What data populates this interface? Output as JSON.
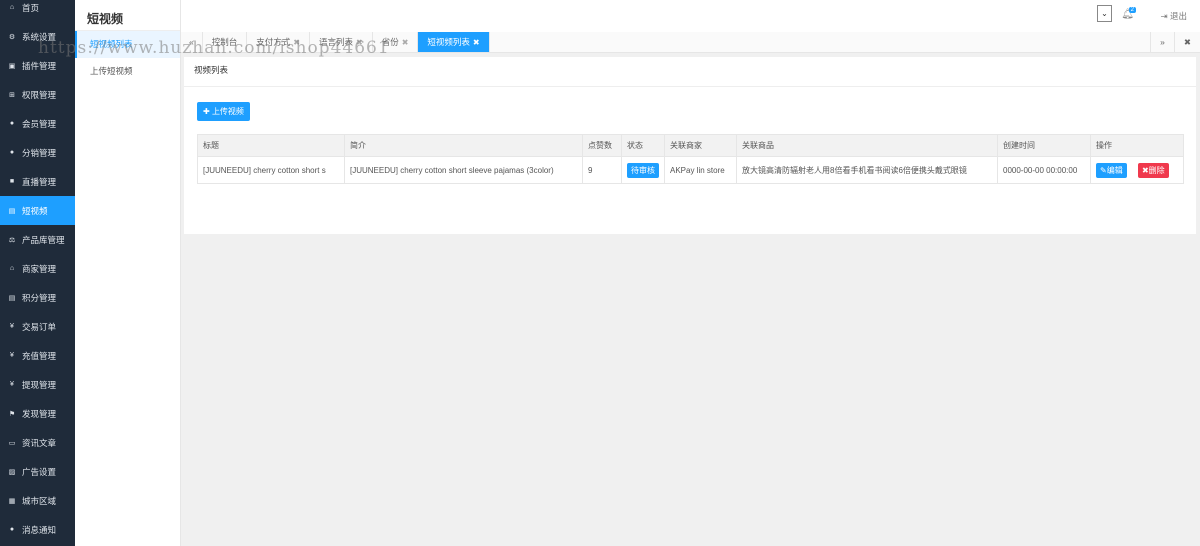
{
  "sidebar": {
    "items": [
      {
        "label": "首页",
        "icon": "home-icon"
      },
      {
        "label": "系统设置",
        "icon": "gear-icon"
      },
      {
        "label": "插件管理",
        "icon": "plugin-icon"
      },
      {
        "label": "权限管理",
        "icon": "sitemap-icon"
      },
      {
        "label": "会员管理",
        "icon": "users-icon"
      },
      {
        "label": "分销管理",
        "icon": "users-icon"
      },
      {
        "label": "直播管理",
        "icon": "video-icon"
      },
      {
        "label": "短视频",
        "icon": "file-icon",
        "active": true
      },
      {
        "label": "产品库管理",
        "icon": "scale-icon"
      },
      {
        "label": "商家管理",
        "icon": "bank-icon"
      },
      {
        "label": "积分管理",
        "icon": "doc-icon"
      },
      {
        "label": "交易订单",
        "icon": "yen-icon"
      },
      {
        "label": "充值管理",
        "icon": "yen-icon"
      },
      {
        "label": "提现管理",
        "icon": "yen-icon"
      },
      {
        "label": "发现管理",
        "icon": "flag-icon"
      },
      {
        "label": "资讯文章",
        "icon": "news-icon"
      },
      {
        "label": "广告设置",
        "icon": "image-icon"
      },
      {
        "label": "城市区域",
        "icon": "map-icon"
      },
      {
        "label": "消息通知",
        "icon": "comment-icon"
      }
    ]
  },
  "subnav": {
    "title": "短视频",
    "items": [
      {
        "label": "短视频列表",
        "active": true
      },
      {
        "label": "上传短视频"
      }
    ]
  },
  "header": {
    "notification_count": "2",
    "logout": "退出"
  },
  "tabs": [
    {
      "label": "控制台"
    },
    {
      "label": "支付方式"
    },
    {
      "label": "语言列表"
    },
    {
      "label": "省份"
    },
    {
      "label": "短视频列表",
      "active": true
    }
  ],
  "card": {
    "title": "视频列表",
    "upload_button": "上传视频"
  },
  "table": {
    "headers": [
      "标题",
      "简介",
      "点赞数",
      "状态",
      "关联商家",
      "关联商品",
      "创建时间",
      "操作"
    ],
    "rows": [
      {
        "title": "[JUUNEEDU] cherry cotton short s",
        "intro": "[JUUNEEDU] cherry cotton short sleeve pajamas (3color)",
        "likes": "9",
        "status": "待审核",
        "merchant": "AKPay lin store",
        "product": "放大镜高清防辐射老人用8倍看手机看书阅读6倍便携头戴式眼镜",
        "created": "0000-00-00 00:00:00",
        "edit": "编辑",
        "delete": "删除"
      }
    ]
  },
  "watermark": "https://www.huzhan.com/ishop44661",
  "colors": {
    "accent": "#1e9fff",
    "danger": "#f0394d",
    "sidebar": "#1f2b3a"
  }
}
